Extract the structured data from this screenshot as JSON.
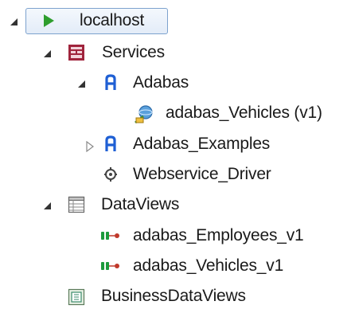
{
  "tree": {
    "root": {
      "label": "localhost",
      "icon": "play-icon",
      "accent": "#2e9e2e",
      "expanded": true,
      "selected": true,
      "children": {
        "services": {
          "label": "Services",
          "icon": "services-icon",
          "expanded": true,
          "children": {
            "adabas": {
              "label": "Adabas",
              "icon": "adabas-icon",
              "expanded": true,
              "children": {
                "vehicles": {
                  "label": "adabas_Vehicles (v1)",
                  "icon": "database-connection-icon"
                }
              }
            },
            "examples": {
              "label": "Adabas_Examples",
              "icon": "adabas-icon",
              "expanded": false
            },
            "webservice": {
              "label": "Webservice_Driver",
              "icon": "driver-icon"
            }
          }
        },
        "dataviews": {
          "label": "DataViews",
          "icon": "table-icon",
          "expanded": true,
          "children": {
            "employees": {
              "label": "adabas_Employees_v1",
              "icon": "dataview-icon"
            },
            "vehicles_v1": {
              "label": "adabas_Vehicles_v1",
              "icon": "dataview-icon"
            }
          }
        },
        "business": {
          "label": "BusinessDataViews",
          "icon": "business-dataview-icon"
        }
      }
    }
  }
}
